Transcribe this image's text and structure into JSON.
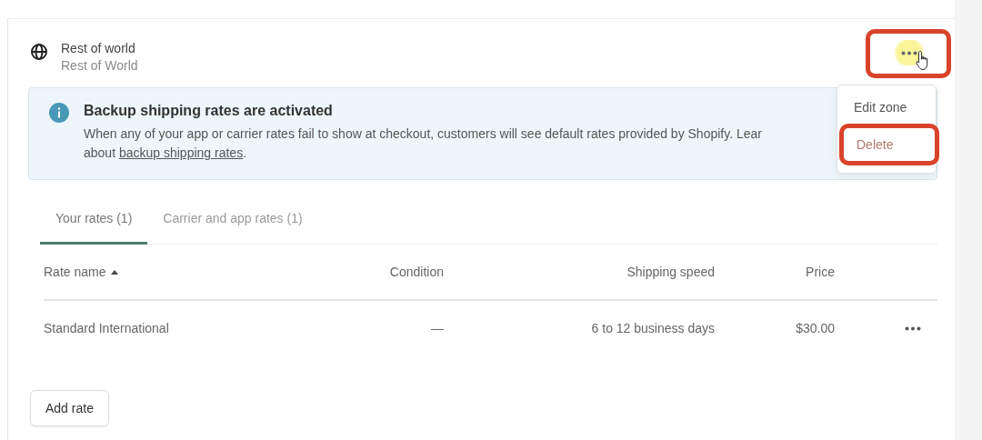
{
  "zone": {
    "title": "Rest of world",
    "subtitle": "Rest of World",
    "actions_button": {
      "annotated": true,
      "hovered": true
    }
  },
  "menu": {
    "open": true,
    "items": [
      {
        "label": "Edit zone",
        "kind": "default",
        "annotated": false
      },
      {
        "label": "Delete",
        "kind": "destructive",
        "annotated": true
      }
    ]
  },
  "banner": {
    "title": "Backup shipping rates are activated",
    "text": "When any of your app or carrier rates fail to show at checkout, customers will see default rates provided by Shopify. Lear",
    "text_2": "about",
    "link": "backup shipping rates",
    "after": "."
  },
  "tabs": [
    {
      "label": "Your rates (1)",
      "selected": true
    },
    {
      "label": "Carrier and app rates (1)",
      "selected": false
    }
  ],
  "table": {
    "columns": [
      {
        "label": "Rate name",
        "sorted": true
      },
      {
        "label": "Condition",
        "sorted": false
      },
      {
        "label": "Shipping speed",
        "sorted": false
      },
      {
        "label": "Price",
        "sorted": false
      }
    ],
    "rows": [
      {
        "cells": [
          "Standard International",
          "—",
          "6 to 12 business days",
          "$30.00"
        ]
      }
    ]
  },
  "add_button": {
    "label": "Add rate"
  }
}
